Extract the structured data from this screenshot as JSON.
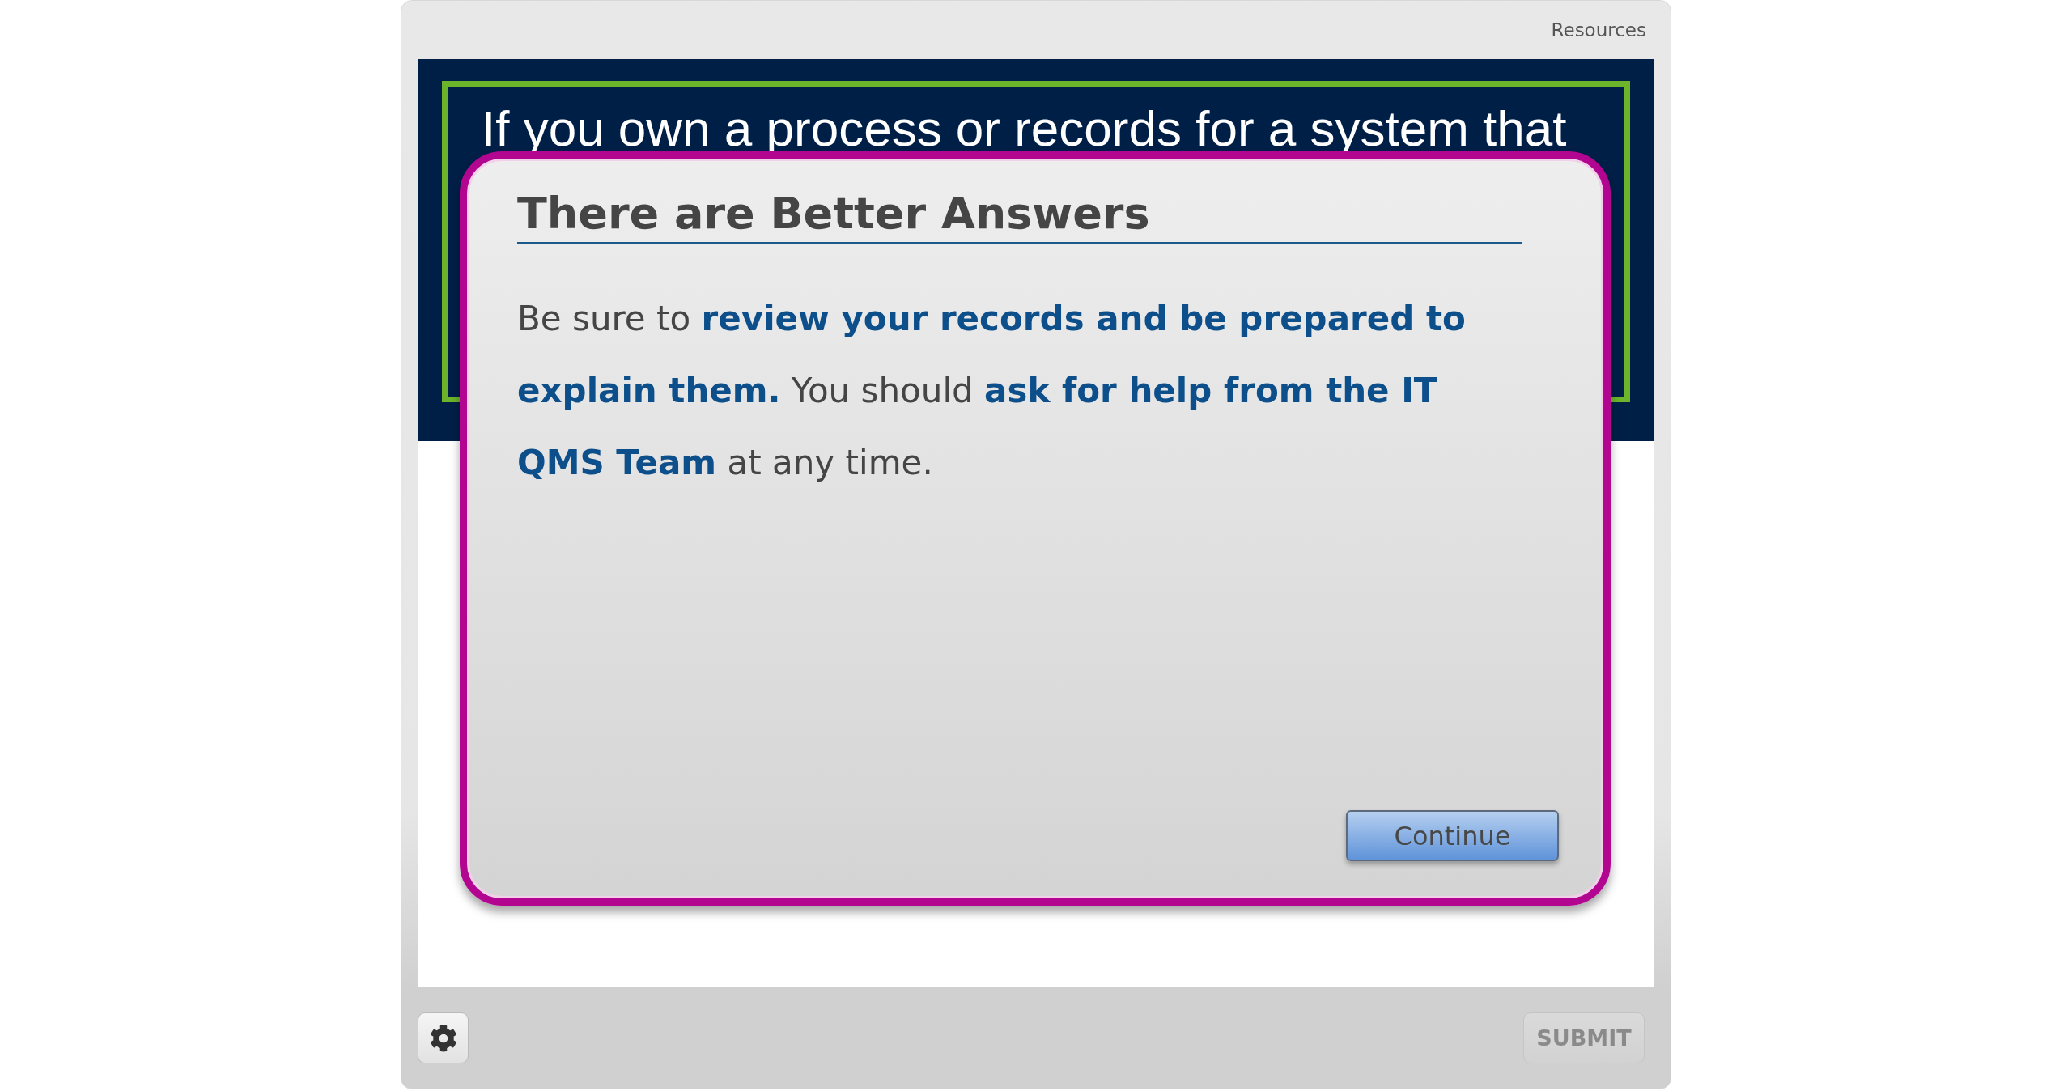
{
  "top_bar": {
    "resources_link": "Resources"
  },
  "slide": {
    "banner_text": "If you own a process or records for a system that"
  },
  "dialog": {
    "title": "There are Better Answers",
    "message": "Be sure to **review your records and be prepared to explain them.** You should **ask for help from the IT QMS Team** at any time.",
    "button": "Continue"
  },
  "bottom_bar": {
    "submit_button": {
      "label": "SUBMIT",
      "disabled": true
    }
  }
}
